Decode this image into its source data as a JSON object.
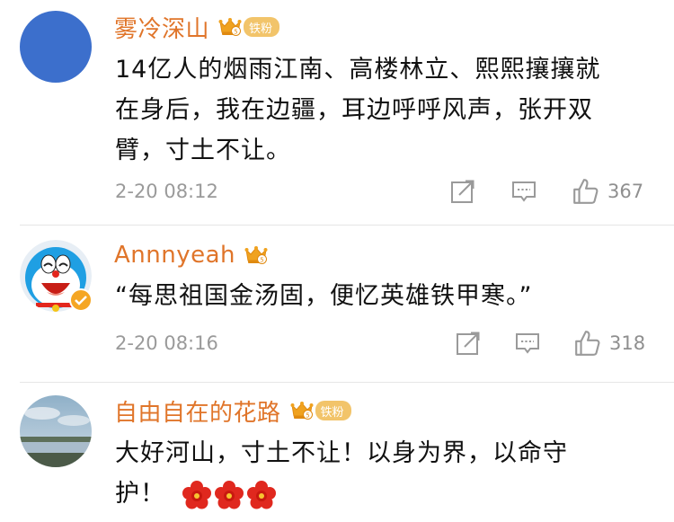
{
  "comments": [
    {
      "username": "雾冷深山",
      "fan_badge": "铁粉",
      "text_lines": [
        "14亿人的烟雨江南、高楼林立、熙熙攘攘就",
        "在身后，我在边疆，耳边呼呼风声，张开双",
        "臂，寸土不让。"
      ],
      "time": "2-20 08:12",
      "likes": "367"
    },
    {
      "username": "Annnyeah",
      "text_lines": [
        "“每思祖国金汤固，便忆英雄铁甲寒。”"
      ],
      "time": "2-20 08:16",
      "likes": "318"
    },
    {
      "username": "自由自在的花路",
      "fan_badge": "铁粉",
      "text_lines": [
        "大好河山，寸土不让！以身为界，以命守",
        "护！"
      ]
    }
  ],
  "colors": {
    "username": "#e0752a",
    "text": "#111111",
    "meta": "#9a9a9a",
    "fan_badge": "#f2c46a",
    "verified": "#f5a623",
    "flower": "#e0281e"
  },
  "icons": {
    "share": "share-icon",
    "comment": "comment-icon",
    "like": "thumbs-up-icon",
    "crown": "crown-level-icon",
    "flower": "red-flower-emoji"
  }
}
